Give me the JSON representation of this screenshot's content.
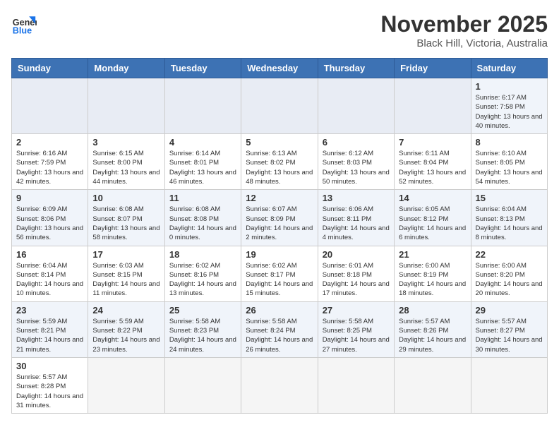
{
  "header": {
    "logo_general": "General",
    "logo_blue": "Blue",
    "title": "November 2025",
    "subtitle": "Black Hill, Victoria, Australia"
  },
  "weekdays": [
    "Sunday",
    "Monday",
    "Tuesday",
    "Wednesday",
    "Thursday",
    "Friday",
    "Saturday"
  ],
  "weeks": [
    [
      {
        "day": "",
        "info": ""
      },
      {
        "day": "",
        "info": ""
      },
      {
        "day": "",
        "info": ""
      },
      {
        "day": "",
        "info": ""
      },
      {
        "day": "",
        "info": ""
      },
      {
        "day": "",
        "info": ""
      },
      {
        "day": "1",
        "info": "Sunrise: 6:17 AM\nSunset: 7:58 PM\nDaylight: 13 hours and 40 minutes."
      }
    ],
    [
      {
        "day": "2",
        "info": "Sunrise: 6:16 AM\nSunset: 7:59 PM\nDaylight: 13 hours and 42 minutes."
      },
      {
        "day": "3",
        "info": "Sunrise: 6:15 AM\nSunset: 8:00 PM\nDaylight: 13 hours and 44 minutes."
      },
      {
        "day": "4",
        "info": "Sunrise: 6:14 AM\nSunset: 8:01 PM\nDaylight: 13 hours and 46 minutes."
      },
      {
        "day": "5",
        "info": "Sunrise: 6:13 AM\nSunset: 8:02 PM\nDaylight: 13 hours and 48 minutes."
      },
      {
        "day": "6",
        "info": "Sunrise: 6:12 AM\nSunset: 8:03 PM\nDaylight: 13 hours and 50 minutes."
      },
      {
        "day": "7",
        "info": "Sunrise: 6:11 AM\nSunset: 8:04 PM\nDaylight: 13 hours and 52 minutes."
      },
      {
        "day": "8",
        "info": "Sunrise: 6:10 AM\nSunset: 8:05 PM\nDaylight: 13 hours and 54 minutes."
      }
    ],
    [
      {
        "day": "9",
        "info": "Sunrise: 6:09 AM\nSunset: 8:06 PM\nDaylight: 13 hours and 56 minutes."
      },
      {
        "day": "10",
        "info": "Sunrise: 6:08 AM\nSunset: 8:07 PM\nDaylight: 13 hours and 58 minutes."
      },
      {
        "day": "11",
        "info": "Sunrise: 6:08 AM\nSunset: 8:08 PM\nDaylight: 14 hours and 0 minutes."
      },
      {
        "day": "12",
        "info": "Sunrise: 6:07 AM\nSunset: 8:09 PM\nDaylight: 14 hours and 2 minutes."
      },
      {
        "day": "13",
        "info": "Sunrise: 6:06 AM\nSunset: 8:11 PM\nDaylight: 14 hours and 4 minutes."
      },
      {
        "day": "14",
        "info": "Sunrise: 6:05 AM\nSunset: 8:12 PM\nDaylight: 14 hours and 6 minutes."
      },
      {
        "day": "15",
        "info": "Sunrise: 6:04 AM\nSunset: 8:13 PM\nDaylight: 14 hours and 8 minutes."
      }
    ],
    [
      {
        "day": "16",
        "info": "Sunrise: 6:04 AM\nSunset: 8:14 PM\nDaylight: 14 hours and 10 minutes."
      },
      {
        "day": "17",
        "info": "Sunrise: 6:03 AM\nSunset: 8:15 PM\nDaylight: 14 hours and 11 minutes."
      },
      {
        "day": "18",
        "info": "Sunrise: 6:02 AM\nSunset: 8:16 PM\nDaylight: 14 hours and 13 minutes."
      },
      {
        "day": "19",
        "info": "Sunrise: 6:02 AM\nSunset: 8:17 PM\nDaylight: 14 hours and 15 minutes."
      },
      {
        "day": "20",
        "info": "Sunrise: 6:01 AM\nSunset: 8:18 PM\nDaylight: 14 hours and 17 minutes."
      },
      {
        "day": "21",
        "info": "Sunrise: 6:00 AM\nSunset: 8:19 PM\nDaylight: 14 hours and 18 minutes."
      },
      {
        "day": "22",
        "info": "Sunrise: 6:00 AM\nSunset: 8:20 PM\nDaylight: 14 hours and 20 minutes."
      }
    ],
    [
      {
        "day": "23",
        "info": "Sunrise: 5:59 AM\nSunset: 8:21 PM\nDaylight: 14 hours and 21 minutes."
      },
      {
        "day": "24",
        "info": "Sunrise: 5:59 AM\nSunset: 8:22 PM\nDaylight: 14 hours and 23 minutes."
      },
      {
        "day": "25",
        "info": "Sunrise: 5:58 AM\nSunset: 8:23 PM\nDaylight: 14 hours and 24 minutes."
      },
      {
        "day": "26",
        "info": "Sunrise: 5:58 AM\nSunset: 8:24 PM\nDaylight: 14 hours and 26 minutes."
      },
      {
        "day": "27",
        "info": "Sunrise: 5:58 AM\nSunset: 8:25 PM\nDaylight: 14 hours and 27 minutes."
      },
      {
        "day": "28",
        "info": "Sunrise: 5:57 AM\nSunset: 8:26 PM\nDaylight: 14 hours and 29 minutes."
      },
      {
        "day": "29",
        "info": "Sunrise: 5:57 AM\nSunset: 8:27 PM\nDaylight: 14 hours and 30 minutes."
      }
    ],
    [
      {
        "day": "30",
        "info": "Sunrise: 5:57 AM\nSunset: 8:28 PM\nDaylight: 14 hours and 31 minutes."
      },
      {
        "day": "",
        "info": ""
      },
      {
        "day": "",
        "info": ""
      },
      {
        "day": "",
        "info": ""
      },
      {
        "day": "",
        "info": ""
      },
      {
        "day": "",
        "info": ""
      },
      {
        "day": "",
        "info": ""
      }
    ]
  ]
}
